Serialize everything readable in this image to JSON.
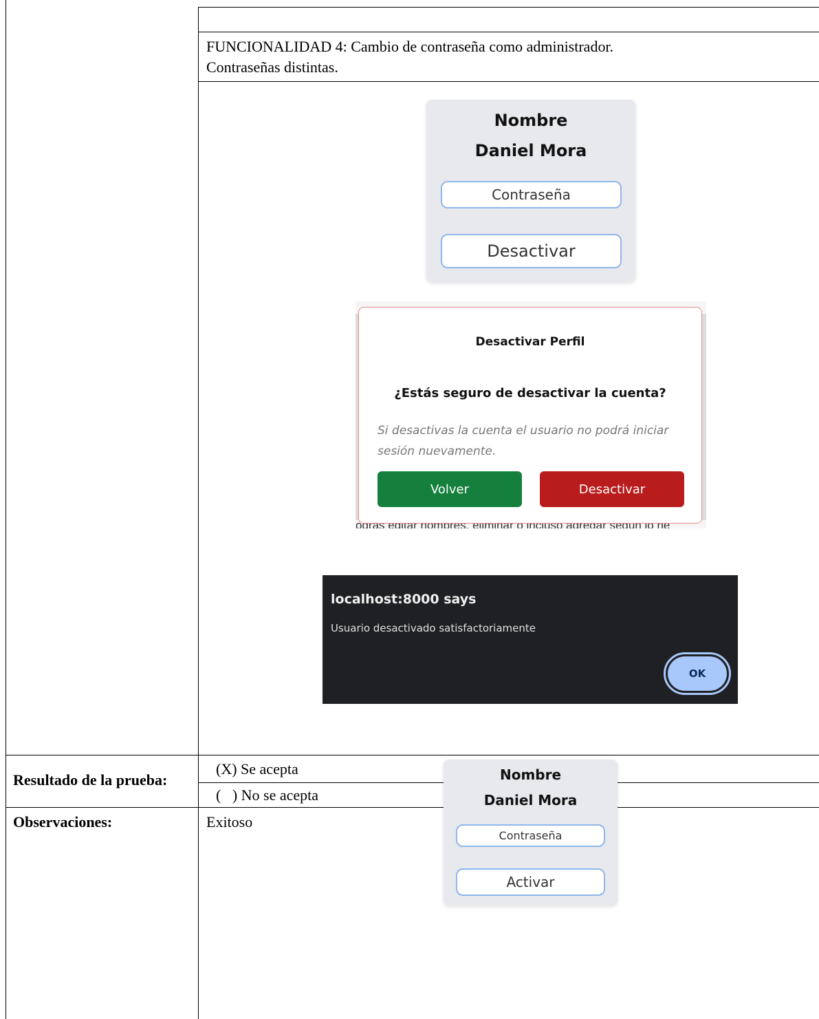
{
  "funcionalidad": {
    "line1": "FUNCIONALIDAD 4: Cambio de contraseña como administrador.",
    "line2": "Contraseñas distintas."
  },
  "card_before": {
    "title1": "Nombre",
    "title2": "Daniel Mora",
    "password_button": "Contraseña",
    "toggle_button": "Desactivar"
  },
  "modal": {
    "title": "Desactivar Perfil",
    "question": "¿Estás seguro de desactivar la cuenta?",
    "note": "Si desactivas la cuenta el usuario no podrá iniciar sesión nuevamente.",
    "back_button": "Volver",
    "confirm_button": "Desactivar",
    "background_text": "odrás editar nombres, eliminar o incluso agregar según lo ne",
    "colors": {
      "back": "#15803d",
      "confirm": "#b91c1c"
    }
  },
  "alert": {
    "title": "localhost:8000 says",
    "message": "Usuario desactivado satisfactoriamente",
    "ok_button": "OK"
  },
  "card_after": {
    "title1": "Nombre",
    "title2": "Daniel Mora",
    "password_button": "Contraseña",
    "toggle_button": "Activar"
  },
  "resultado": {
    "label": "Resultado de la prueba:",
    "accept": "(X) Se acepta",
    "reject": "(   ) No se acepta"
  },
  "observaciones": {
    "label": "Observaciones:",
    "value": "Exitoso"
  }
}
